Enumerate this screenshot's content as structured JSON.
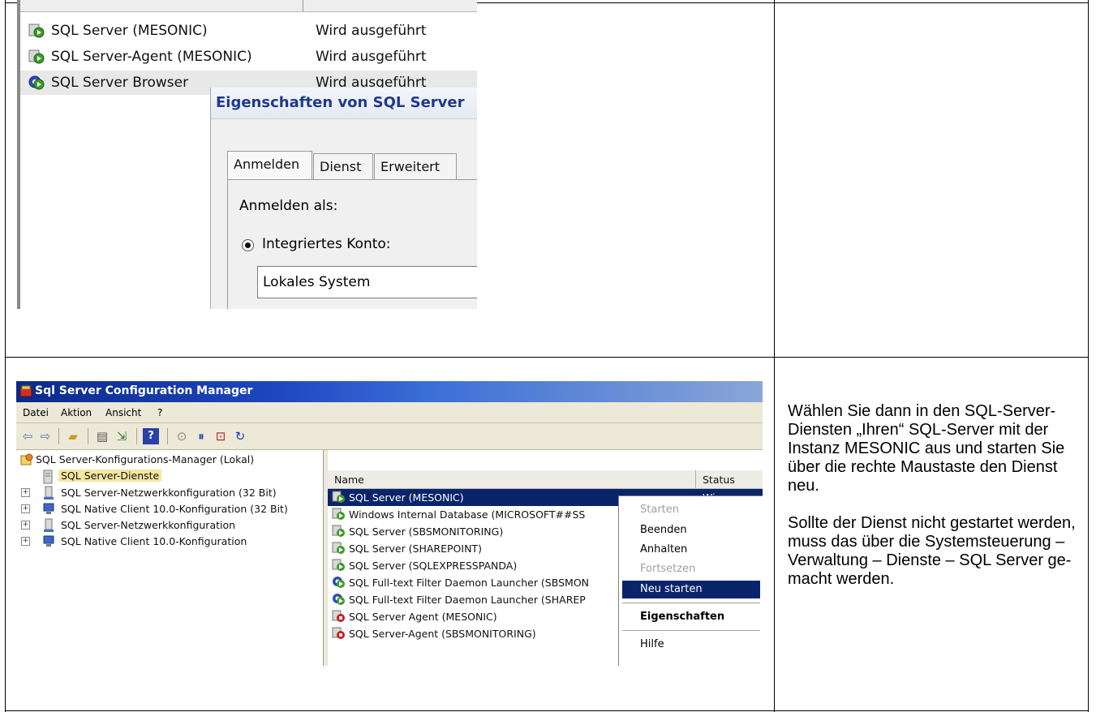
{
  "top_screenshot": {
    "services": [
      {
        "name": "SQL Server (MESONIC)",
        "status": "Wird ausgeführt"
      },
      {
        "name": "SQL Server-Agent (MESONIC)",
        "status": "Wird ausgeführt"
      },
      {
        "name": "SQL Server Browser",
        "status": "Wird ausgeführt"
      }
    ],
    "dialog": {
      "title": "Eigenschaften von SQL Server",
      "tabs": [
        "Anmelden",
        "Dienst",
        "Erweitert"
      ],
      "login_label": "Anmelden als:",
      "builtin_account_label": "Integriertes Konto:",
      "account_value": "Lokales System"
    }
  },
  "bottom_screenshot": {
    "window_title": "Sql Server Configuration Manager",
    "menu": [
      "Datei",
      "Aktion",
      "Ansicht",
      "?"
    ],
    "tree": {
      "root": "SQL Server-Konfigurations-Manager (Lokal)",
      "items": [
        "SQL Server-Dienste",
        "SQL Server-Netzwerkkonfiguration (32 Bit)",
        "SQL Native Client 10.0-Konfiguration (32 Bit)",
        "SQL Server-Netzwerkkonfiguration",
        "SQL Native Client 10.0-Konfiguration"
      ]
    },
    "list": {
      "col_name": "Name",
      "col_status": "Status",
      "rows": [
        "SQL Server (MESONIC)",
        "Windows Internal Database (MICROSOFT##SS",
        "SQL Server (SBSMONITORING)",
        "SQL Server (SHAREPOINT)",
        "SQL Server (SQLEXPRESSPANDA)",
        "SQL Full-text Filter Daemon Launcher (SBSMON",
        "SQL Full-text Filter Daemon Launcher (SHAREP",
        "SQL Server Agent (MESONIC)",
        "SQL Server-Agent (SBSMONITORING)"
      ],
      "first_row_status_fragment": "Wi"
    },
    "context_menu": {
      "start": "Starten",
      "stop": "Beenden",
      "pause": "Anhalten",
      "resume": "Fortsetzen",
      "restart": "Neu starten",
      "properties": "Eigenschaften",
      "help": "Hilfe"
    }
  },
  "instructions": {
    "p1": "Wählen Sie dann in den SQL-Server-Diensten „Ihren“ SQL-Server mit der Instanz MESONIC aus und starten Sie über die rechte Maustaste den Dienst neu.",
    "p2": "Sollte der Dienst nicht gestartet werden, muss das über die Systemsteuerung – Verwaltung – Dienste – SQL Server ge-macht werden."
  }
}
